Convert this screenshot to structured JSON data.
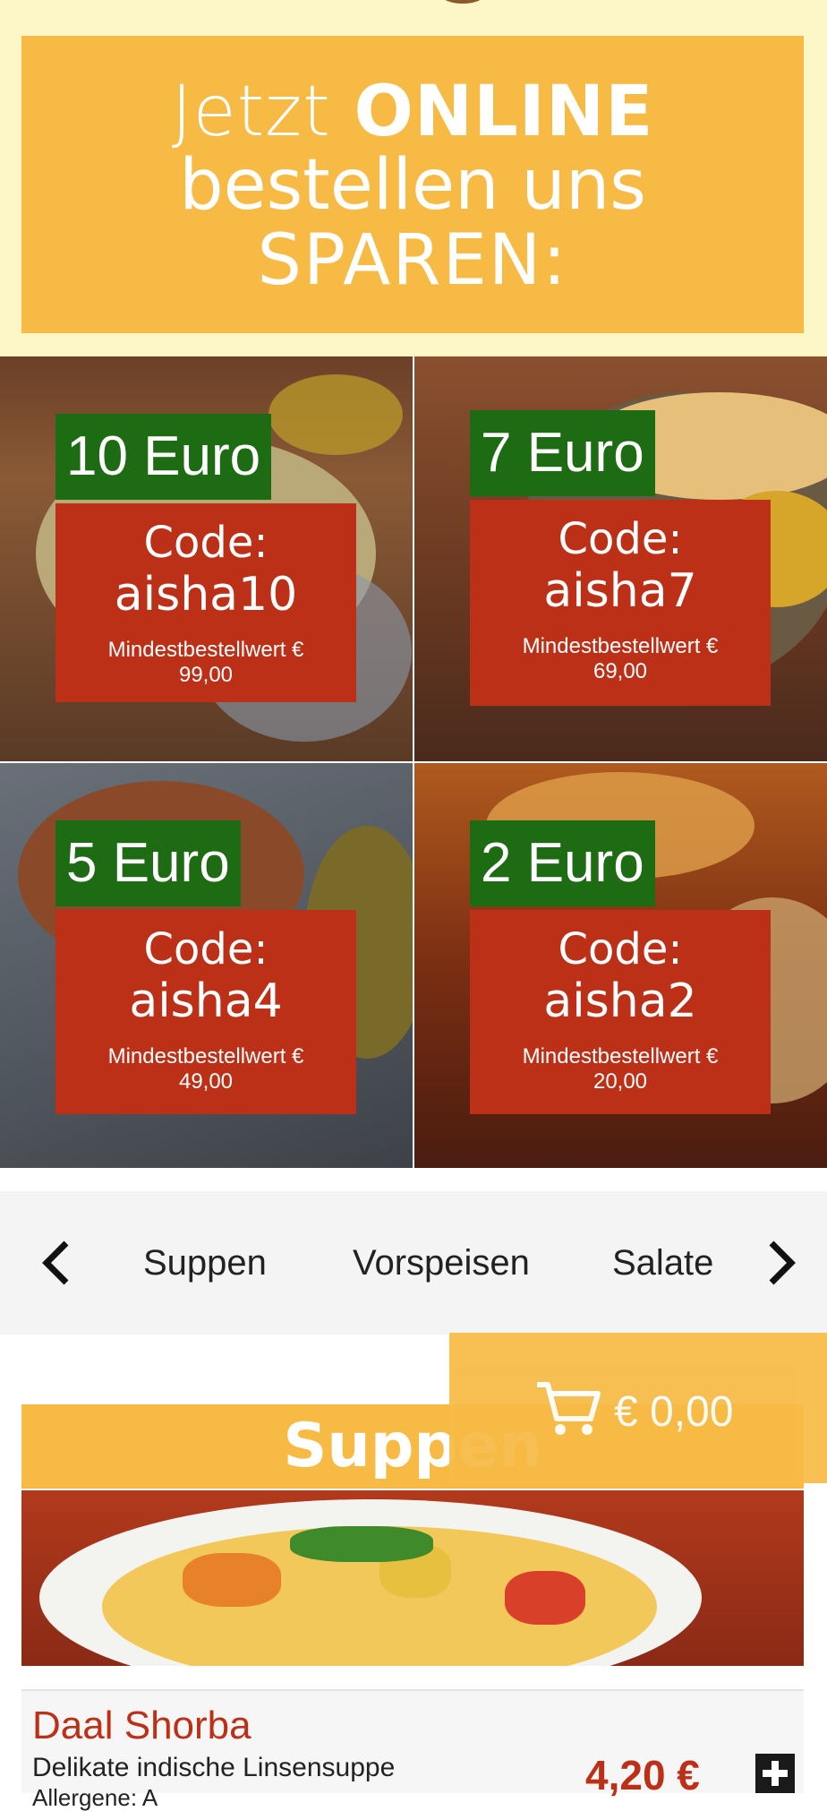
{
  "promo": {
    "line1_thin": "Jetzt",
    "line1_bold": "ONLINE",
    "line2": "bestellen uns",
    "line3": "SPAREN:"
  },
  "coupons": [
    {
      "amount": "10 Euro",
      "code_label": "Code:",
      "code": "aisha10",
      "min_label": "Mindestbestellwert €",
      "min_value": "99,00"
    },
    {
      "amount": "7 Euro",
      "code_label": "Code:",
      "code": "aisha7",
      "min_label": "Mindestbestellwert €",
      "min_value": "69,00"
    },
    {
      "amount": "5 Euro",
      "code_label": "Code:",
      "code": "aisha4",
      "min_label": "Mindestbestellwert €",
      "min_value": "49,00"
    },
    {
      "amount": "2 Euro",
      "code_label": "Code:",
      "code": "aisha2",
      "min_label": "Mindestbestellwert €",
      "min_value": "20,00"
    }
  ],
  "category_nav": {
    "items": [
      "Suppen",
      "Vorspeisen",
      "Salate"
    ]
  },
  "section": {
    "title": "Suppen"
  },
  "cart": {
    "total": "€ 0,00"
  },
  "menu_items": [
    {
      "name": "Daal Shorba",
      "description": "Delikate indische Linsensuppe",
      "allergens": "Allergene: A",
      "price": "4,20 €"
    }
  ],
  "colors": {
    "accent": "#f7bb45",
    "coupon_amount": "#1d6b12",
    "coupon_code": "#bd3018",
    "price": "#bd3018"
  }
}
